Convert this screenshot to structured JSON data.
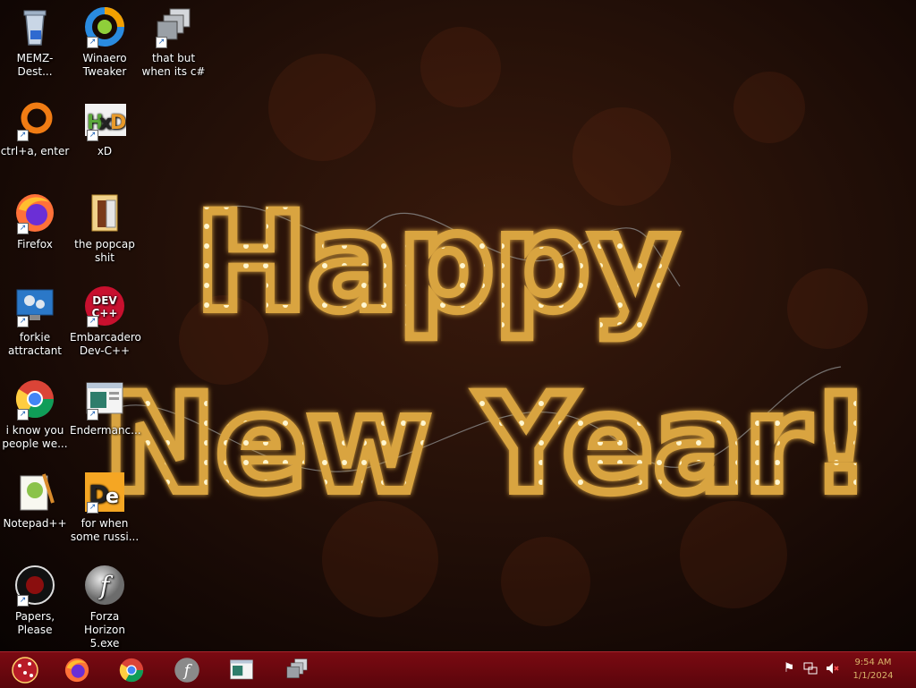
{
  "desktop": {
    "icons": [
      {
        "label": "MEMZ-Dest...",
        "icon": "recycle-bin-icon"
      },
      {
        "label": "Winaero Tweaker",
        "icon": "winaero-tweaker-icon"
      },
      {
        "label": "that but when its c#",
        "icon": "windows-stack-icon"
      },
      {
        "label": "ctrl+a, enter",
        "icon": "orange-ring-icon"
      },
      {
        "label": "xD",
        "icon": "hxd-icon"
      },
      {
        "label": "Firefox",
        "icon": "firefox-icon"
      },
      {
        "label": "the popcap shit",
        "icon": "folder-icon"
      },
      {
        "label": "forkie attractant",
        "icon": "monitor-gear-icon"
      },
      {
        "label": "Embarcadero Dev-C++",
        "icon": "dev-cpp-icon"
      },
      {
        "label": "i know you people we...",
        "icon": "chrome-icon"
      },
      {
        "label": "Endermanc...",
        "icon": "window-app-icon"
      },
      {
        "label": "Notepad++",
        "icon": "notepad-plus-plus-icon"
      },
      {
        "label": "for when some russi...",
        "icon": "de-app-icon"
      },
      {
        "label": "Papers, Please",
        "icon": "papers-please-icon"
      },
      {
        "label": "Forza Horizon 5.exe",
        "icon": "flash-player-icon"
      }
    ]
  },
  "greeting": {
    "line1": "Happy",
    "line2": "New Year!"
  },
  "taskbar": {
    "pinned": [
      "firefox-icon",
      "chrome-icon",
      "flash-player-icon",
      "window-app-icon",
      "windows-stack-icon"
    ],
    "tray": [
      "flag-icon",
      "network-icon",
      "volume-muted-icon"
    ],
    "clock": {
      "time": "9:54 AM",
      "date": "1/1/2024"
    }
  },
  "colors": {
    "taskbar": "#6a0810",
    "bulb": "#ffe9a0",
    "glow": "#e8a437"
  }
}
